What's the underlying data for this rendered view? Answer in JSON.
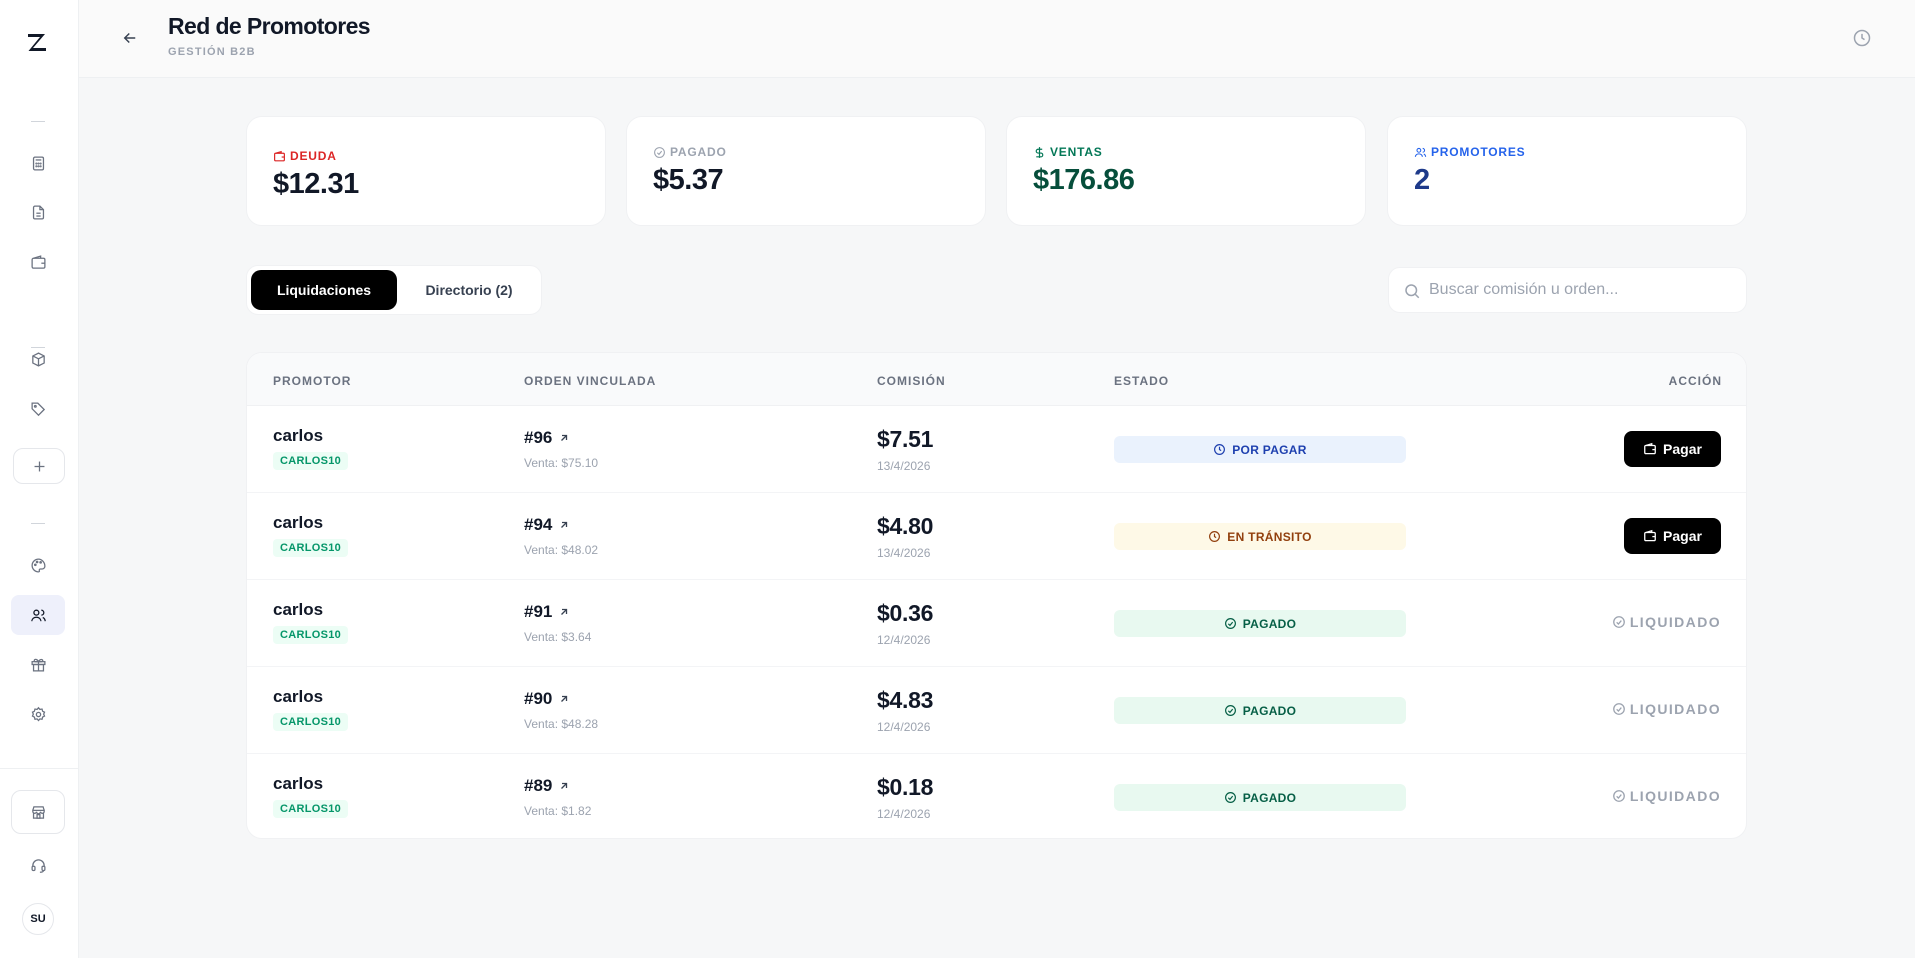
{
  "header": {
    "title": "Red de Promotores",
    "subtitle": "GESTIÓN B2B"
  },
  "sidebar": {
    "avatar_initials": "SU",
    "items": [
      "calculator-icon",
      "document-icon",
      "wallet-icon",
      "package-icon",
      "tag-icon",
      "plus-icon",
      "palette-icon",
      "users-icon",
      "gift-icon",
      "gear-icon",
      "store-icon",
      "headset-icon"
    ],
    "active_item": "users-icon"
  },
  "stats": [
    {
      "label": "DEUDA",
      "value": "$12.31",
      "color": "#dc2626",
      "value_color": "#111827",
      "icon": "wallet-icon"
    },
    {
      "label": "PAGADO",
      "value": "$5.37",
      "color": "#9ca3af",
      "value_color": "#111827",
      "icon": "check-circle-icon"
    },
    {
      "label": "VENTAS",
      "value": "$176.86",
      "color": "#047857",
      "value_color": "#064e3b",
      "icon": "dollar-icon"
    },
    {
      "label": "PROMOTORES",
      "value": "2",
      "color": "#2563eb",
      "value_color": "#1e3a8a",
      "icon": "users-icon"
    }
  ],
  "tabs": {
    "active": "Liquidaciones",
    "other": "Directorio (2)"
  },
  "search": {
    "placeholder": "Buscar comisión u orden..."
  },
  "table": {
    "columns": [
      "PROMOTOR",
      "ORDEN VINCULADA",
      "COMISIÓN",
      "ESTADO",
      "ACCIÓN"
    ],
    "pay_label": "Pagar",
    "settled_label": "LIQUIDADO",
    "rows": [
      {
        "promoter": "carlos",
        "code": "CARLOS10",
        "order": "#96",
        "sale": "Venta: $75.10",
        "amount": "$7.51",
        "date": "13/4/2026",
        "status": "POR PAGAR",
        "status_type": "porpagar",
        "action": "pay"
      },
      {
        "promoter": "carlos",
        "code": "CARLOS10",
        "order": "#94",
        "sale": "Venta: $48.02",
        "amount": "$4.80",
        "date": "13/4/2026",
        "status": "EN TRÁNSITO",
        "status_type": "transito",
        "action": "pay"
      },
      {
        "promoter": "carlos",
        "code": "CARLOS10",
        "order": "#91",
        "sale": "Venta: $3.64",
        "amount": "$0.36",
        "date": "12/4/2026",
        "status": "PAGADO",
        "status_type": "pagado",
        "action": "settled"
      },
      {
        "promoter": "carlos",
        "code": "CARLOS10",
        "order": "#90",
        "sale": "Venta: $48.28",
        "amount": "$4.83",
        "date": "12/4/2026",
        "status": "PAGADO",
        "status_type": "pagado",
        "action": "settled"
      },
      {
        "promoter": "carlos",
        "code": "CARLOS10",
        "order": "#89",
        "sale": "Venta: $1.82",
        "amount": "$0.18",
        "date": "12/4/2026",
        "status": "PAGADO",
        "status_type": "pagado",
        "action": "settled"
      }
    ]
  }
}
